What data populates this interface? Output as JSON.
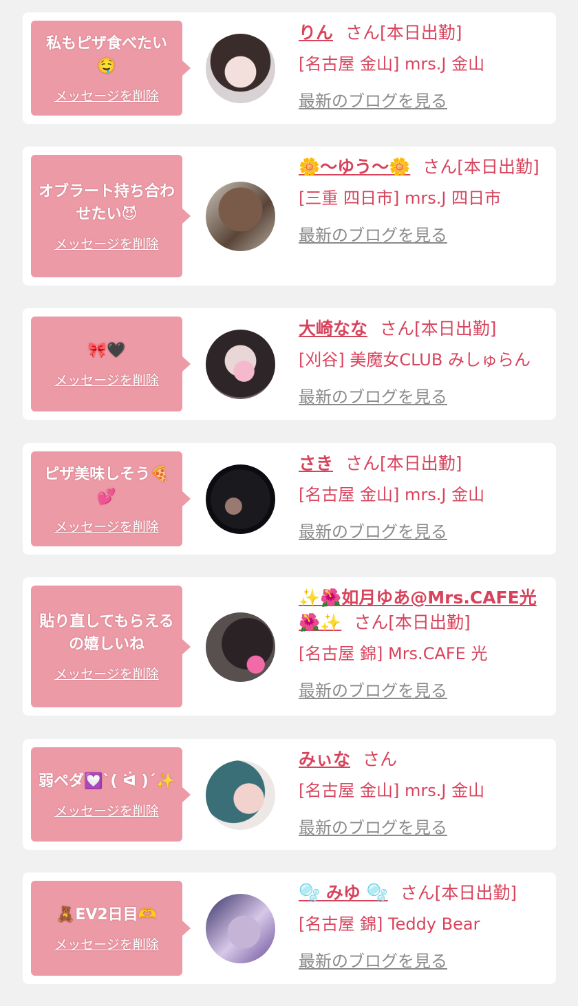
{
  "delete_label": "メッセージを削除",
  "blog_label": "最新のブログを見る",
  "cards": [
    {
      "message": "私もピザ食べたい🤤",
      "name": "りん",
      "suffix": "さん[本日出勤]",
      "shop": "[名古屋 金山] mrs.J 金山"
    },
    {
      "message": "オブラート持ち合わせたい😈",
      "name": "🌼〜ゆう〜🌼",
      "suffix": "さん[本日出勤]",
      "shop": "[三重 四日市] mrs.J 四日市"
    },
    {
      "message": "🎀🖤",
      "name": "大崎なな",
      "suffix": "さん[本日出勤]",
      "shop": "[刈谷] 美魔女CLUB みしゅらん"
    },
    {
      "message": "ピザ美味しそう🍕💕",
      "name": "さき",
      "suffix": "さん[本日出勤]",
      "shop": "[名古屋 金山] mrs.J 金山"
    },
    {
      "message": "貼り直してもらえるの嬉しいね",
      "name": "✨🌺如月ゆあ@Mrs.CAFE光🌺✨",
      "suffix": "さん[本日出勤]",
      "shop": "[名古屋 錦] Mrs.CAFE 光"
    },
    {
      "message": "弱ペダ💟ˋ( ᐛ )ˊ✨",
      "name": "みぃな",
      "suffix": "さん",
      "shop": "[名古屋 金山] mrs.J 金山"
    },
    {
      "message": "🧸EV2日目🫶",
      "name": "🫧 みゆ 🫧",
      "suffix": "さん[本日出勤]",
      "shop": "[名古屋 錦] Teddy Bear"
    }
  ]
}
